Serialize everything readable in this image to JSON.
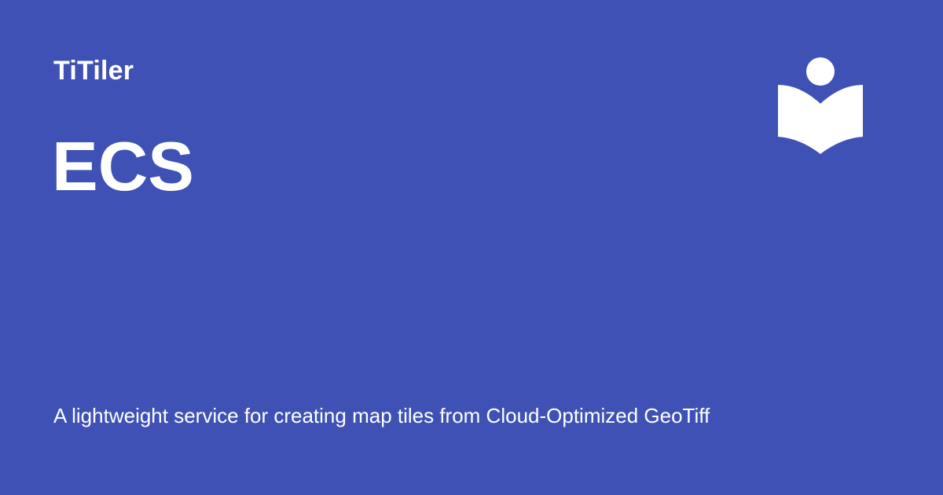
{
  "site": {
    "name": "TiTiler"
  },
  "page": {
    "title": "ECS",
    "description": "A lightweight service for creating map tiles from Cloud-Optimized GeoTiff"
  },
  "logo": {
    "icon": "reader-book-icon"
  },
  "colors": {
    "background": "#3f51b5",
    "foreground": "#ffffff"
  }
}
